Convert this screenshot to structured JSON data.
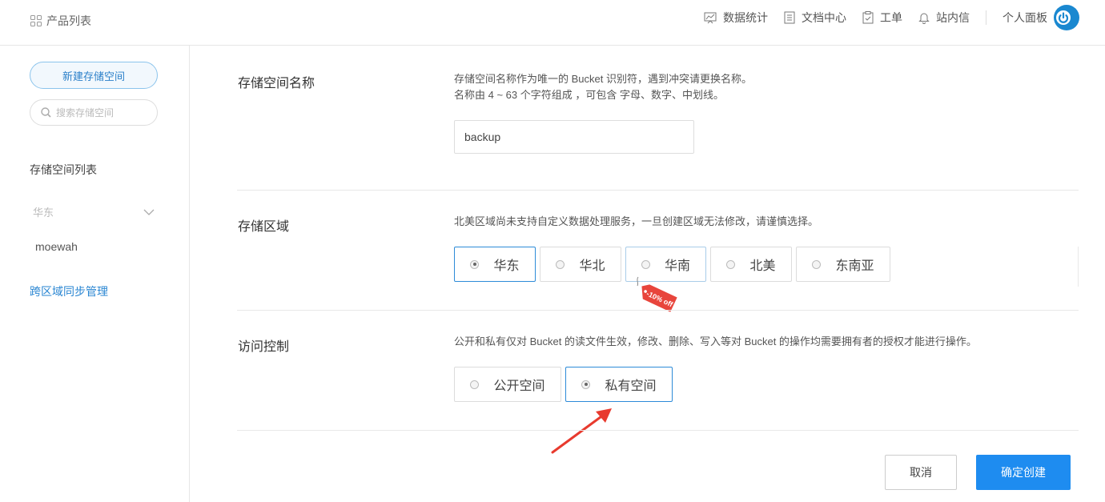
{
  "topbar": {
    "product_list": "产品列表",
    "nav": {
      "stats": "数据统计",
      "docs": "文档中心",
      "tickets": "工单",
      "messages": "站内信",
      "profile": "个人面板"
    }
  },
  "sidebar": {
    "new_bucket": "新建存储空间",
    "search_placeholder": "搜索存储空间",
    "list_title": "存储空间列表",
    "region": "华东",
    "buckets": [
      "moewah"
    ],
    "cross_region": "跨区域同步管理"
  },
  "form": {
    "name": {
      "label": "存储空间名称",
      "desc1": "存储空间名称作为唯一的 Bucket 识别符，遇到冲突请更换名称。",
      "desc2": "名称由 4 ~ 63 个字符组成 ，可包含 字母、数字、中划线。",
      "value": "backup"
    },
    "region": {
      "label": "存储区域",
      "desc": "北美区域尚未支持自定义数据处理服务，一旦创建区域无法修改，请谨慎选择。",
      "options": [
        "华东",
        "华北",
        "华南",
        "北美",
        "东南亚"
      ],
      "selected": "华东",
      "tag": "-10% off"
    },
    "access": {
      "label": "访问控制",
      "desc": "公开和私有仅对 Bucket 的读文件生效，修改、删除、写入等对 Bucket 的操作均需要拥有者的授权才能进行操作。",
      "options": [
        "公开空间",
        "私有空间"
      ],
      "selected": "私有空间"
    }
  },
  "actions": {
    "cancel": "取消",
    "confirm": "确定创建"
  },
  "colors": {
    "accent": "#1e8cf0",
    "link": "#2a86d2",
    "tag": "#e8453c",
    "arrow": "#e83a2e"
  }
}
